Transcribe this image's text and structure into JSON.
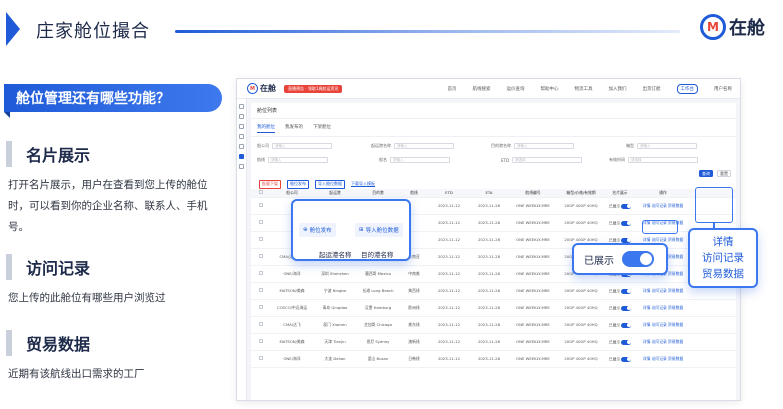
{
  "slide": {
    "title": "庄家舱位撮合",
    "logo_mark": "M",
    "logo_text": "在舱",
    "question": "舱位管理还有哪些功能？"
  },
  "features": [
    {
      "title": "名片展示",
      "desc": "打开名片展示，用户在查看到您上传的舱位时，可以看到你的企业名称、联系人、手机号。"
    },
    {
      "title": "访问记录",
      "desc": "您上传的此舱位有哪些用户浏览过"
    },
    {
      "title": "贸易数据",
      "desc": "近期有该航线出口需求的工厂"
    }
  ],
  "app": {
    "logo_text": "在舱",
    "promo": "直播预告 · 领取1周航运资讯",
    "nav": [
      "首页",
      "航线搜索",
      "运价查询",
      "帮助中心",
      "物流工具",
      "加入我们",
      "出货订舱",
      "工作台",
      "用户名称"
    ],
    "breadcrumb": "舱位列表",
    "tabs": [
      "我的舱位",
      "我发布的",
      "下架舱位"
    ],
    "filters": [
      {
        "label": "船公司",
        "placeholder": "请输入"
      },
      {
        "label": "起运港名称",
        "placeholder": "请输入"
      },
      {
        "label": "目的港名称",
        "placeholder": "请输入"
      },
      {
        "label": "箱型",
        "placeholder": "请输入"
      },
      {
        "label": "航线",
        "placeholder": "请输入"
      },
      {
        "label": "船名",
        "placeholder": "请输入"
      },
      {
        "label": "ETD",
        "placeholder": "请选择"
      },
      {
        "label": "有效时间",
        "placeholder": "请选择"
      }
    ],
    "search_label": "查询",
    "reset_label": "重置",
    "toolbar": {
      "delete": "批量下架",
      "publish": "舱位发布",
      "import": "导入舱位数据",
      "template": "下载导入模板"
    },
    "columns": [
      "",
      "船公司",
      "起运港",
      "目的港",
      "航线",
      "ETD",
      "ETA",
      "航线编号",
      "箱型/价格/有效期",
      "名片展示",
      "操作"
    ],
    "rows": [
      {
        "carrier": "",
        "pol": "",
        "pod": "",
        "route": "",
        "etd": "2023-11-12",
        "eta": "2023-11-28",
        "code": "ONE WEEKLY-MRE",
        "price": "20GP 40GP 40HQ",
        "shown": "已展示",
        "ops": "详情 访问记录 贸易数据"
      },
      {
        "carrier": "",
        "pol": "",
        "pod": "",
        "route": "",
        "etd": "2023-11-12",
        "eta": "2023-11-28",
        "code": "ONE WEEKLY-MRE",
        "price": "20GP 40GP 40HQ",
        "shown": "已展示",
        "ops": "详情 访问记录 贸易数据"
      },
      {
        "carrier": "",
        "pol": "",
        "pod": "",
        "route": "",
        "etd": "2023-11-12",
        "eta": "2023-11-28",
        "code": "ONE WEEKLY-MRE",
        "price": "20GP 40GP 40HQ",
        "shown": "已展示",
        "ops": "详情 访问记录 贸易数据"
      },
      {
        "carrier": "CMA/达飞海运",
        "pol": "上海 Shanghai",
        "pod": "曼谷 Bangkok",
        "route": "东南亚",
        "etd": "2023-11-12",
        "eta": "2023-11-28",
        "code": "ONE WEEKLY-MRE",
        "price": "20GP 40GP 40HQ",
        "shown": "已展示",
        "ops": "详情 访问记录 贸易数据"
      },
      {
        "carrier": "ONE/海洋",
        "pol": "深圳 Shenzhen",
        "pod": "墨西哥 Mexico",
        "route": "中南美",
        "etd": "2023-11-12",
        "eta": "2023-11-28",
        "code": "ONE WEEKLY-MRE",
        "price": "20GP 40GP 40HQ",
        "shown": "已展示",
        "ops": "详情 访问记录 贸易数据"
      },
      {
        "carrier": "MATSON/美森",
        "pol": "宁波 Ningbo",
        "pod": "长滩 Long Beach",
        "route": "美西线",
        "etd": "2023-11-12",
        "eta": "2023-11-28",
        "code": "ONE WEEKLY-MRE",
        "price": "20GP 40GP 40HQ",
        "shown": "已展示",
        "ops": "详情 访问记录 贸易数据"
      },
      {
        "carrier": "COSCO/中远海运",
        "pol": "青岛 Qingdao",
        "pod": "汉堡 Hamburg",
        "route": "欧洲线",
        "etd": "2023-11-12",
        "eta": "2023-11-28",
        "code": "ONE WEEKLY-MRE",
        "price": "20GP 40GP 40HQ",
        "shown": "已展示",
        "ops": "详情 访问记录 贸易数据"
      },
      {
        "carrier": "CMA/达飞",
        "pol": "厦门 Xiamen",
        "pod": "芝加哥 Chicago",
        "route": "美东线",
        "etd": "2023-11-12",
        "eta": "2023-11-28",
        "code": "ONE WEEKLY-MRE",
        "price": "20GP 40GP 40HQ",
        "shown": "已展示",
        "ops": "详情 访问记录 贸易数据"
      },
      {
        "carrier": "MATSON/美森",
        "pol": "天津 Tianjin",
        "pod": "悉尼 Sydney",
        "route": "澳新线",
        "etd": "2023-11-12",
        "eta": "2023-11-28",
        "code": "ONE WEEKLY-MRE",
        "price": "20GP 40GP 40HQ",
        "shown": "已展示",
        "ops": "详情 访问记录 贸易数据"
      },
      {
        "carrier": "ONE/海洋",
        "pol": "大连 Dalian",
        "pod": "釜山 Busan",
        "route": "日韩线",
        "etd": "2023-11-12",
        "eta": "2023-11-28",
        "code": "ONE WEEKLY-MRE",
        "price": "20GP 40GP 40HQ",
        "shown": "已展示",
        "ops": "详情 访问记录 贸易数据"
      }
    ]
  },
  "callouts": {
    "publish": "舱位发布",
    "import": "导入舱位数据",
    "col_pol": "起运港名称",
    "col_pod": "目的港名称",
    "shown_label": "已展示",
    "ops": [
      "详情",
      "访问记录",
      "贸易数据"
    ]
  },
  "colors": {
    "accent": "#1f5bd8",
    "danger": "#e8443a",
    "text": "#1d2a4a"
  }
}
